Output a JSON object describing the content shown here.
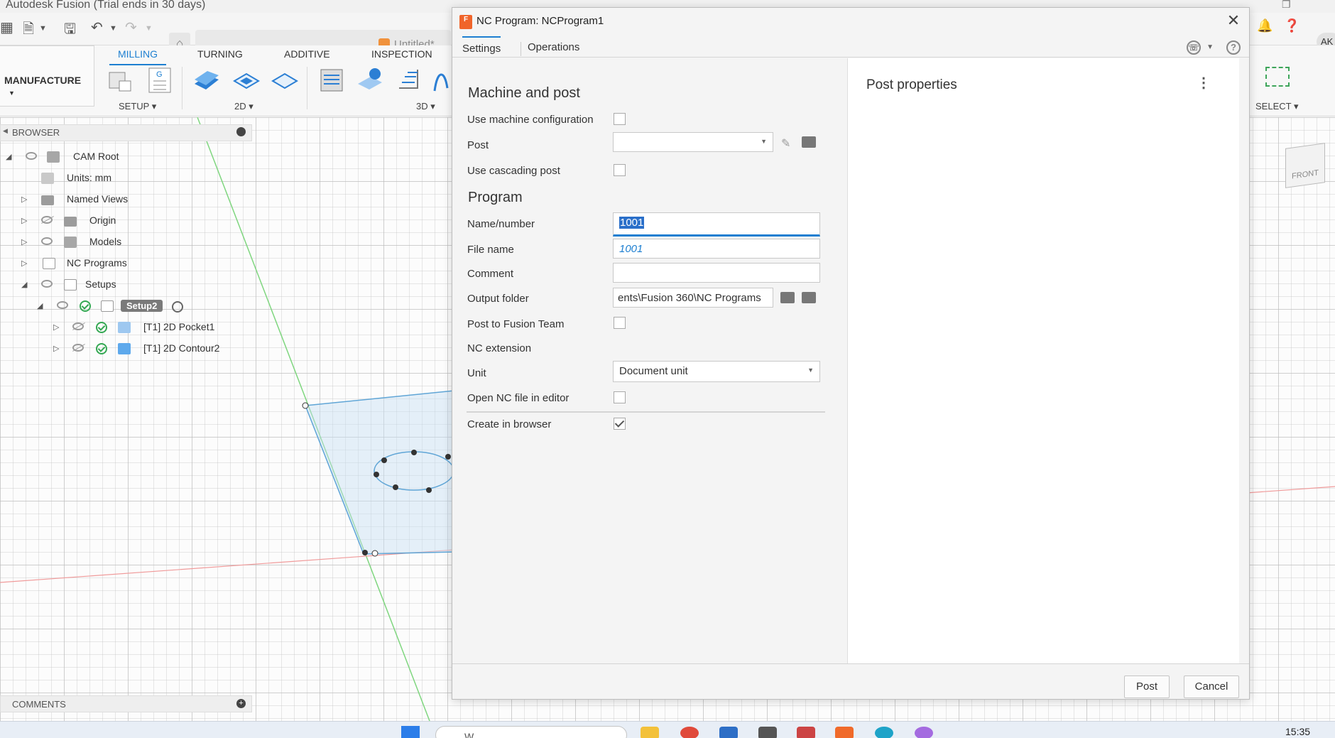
{
  "app": {
    "window_title": "Autodesk Fusion (Trial ends in 30 days)",
    "document_title": "Untitled*",
    "user_initials": "AK"
  },
  "ribbon": {
    "workspace": "MANUFACTURE",
    "tabs": [
      "MILLING",
      "TURNING",
      "ADDITIVE",
      "INSPECTION"
    ],
    "active_tab": "MILLING",
    "groups": [
      "SETUP",
      "2D",
      "3D"
    ],
    "select_label": "SELECT"
  },
  "browser": {
    "header": "BROWSER",
    "items": [
      {
        "label": "CAM Root"
      },
      {
        "label": "Units: mm"
      },
      {
        "label": "Named Views"
      },
      {
        "label": "Origin"
      },
      {
        "label": "Models"
      },
      {
        "label": "NC Programs"
      },
      {
        "label": "Setups"
      },
      {
        "label": "Setup2"
      },
      {
        "label": "[T1] 2D Pocket1"
      },
      {
        "label": "[T1] 2D Contour2"
      }
    ]
  },
  "comments": {
    "header": "COMMENTS"
  },
  "viewcube": {
    "face": "FRONT"
  },
  "taskbar": {
    "search_placeholder": "W",
    "time": "15:35"
  },
  "dialog": {
    "title": "NC Program: NCProgram1",
    "tabs": {
      "settings": "Settings",
      "operations": "Operations"
    },
    "machine_and_post": {
      "title": "Machine and post",
      "use_machine_configuration": "Use machine configuration",
      "post": "Post",
      "post_value": "",
      "use_cascading_post": "Use cascading post"
    },
    "program": {
      "title": "Program",
      "name_number_label": "Name/number",
      "name_number_value": "1001",
      "file_name_label": "File name",
      "file_name_value": "1001",
      "comment_label": "Comment",
      "comment_value": "",
      "output_folder_label": "Output folder",
      "output_folder_value": "ents\\Fusion 360\\NC Programs",
      "post_to_fusion_team_label": "Post to Fusion Team",
      "nc_extension_label": "NC extension",
      "unit_label": "Unit",
      "unit_value": "Document unit",
      "open_nc_in_editor_label": "Open NC file in editor",
      "create_in_browser_label": "Create in browser"
    },
    "checkboxes": {
      "use_machine_configuration": false,
      "use_cascading_post": false,
      "post_to_fusion_team": false,
      "open_nc_in_editor": false,
      "create_in_browser": true
    },
    "post_properties": {
      "title": "Post properties"
    },
    "buttons": {
      "post": "Post",
      "cancel": "Cancel"
    }
  },
  "colors": {
    "accent": "#1d7fd1",
    "brand_orange": "#f0642a",
    "ok_green": "#34a853"
  }
}
